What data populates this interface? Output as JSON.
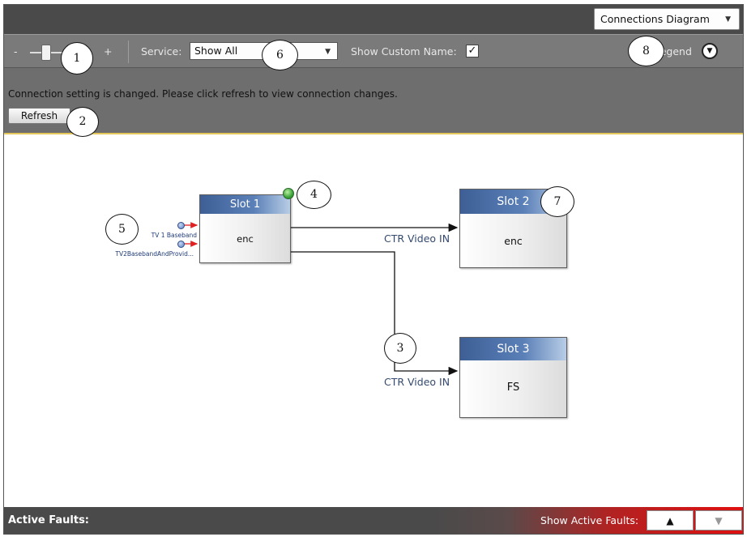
{
  "header": {
    "view_selector": "Connections Diagram",
    "view_caret": "▼"
  },
  "toolbar": {
    "zoom_minus": "-",
    "zoom_plus": "+",
    "zoom_level": 0.27,
    "service_label": "Service:",
    "service_value": "Show All",
    "service_caret": "▼",
    "custom_name_label": "Show Custom Name:",
    "custom_name_checked": true,
    "custom_name_mark": "✓",
    "legend_label": "Legend",
    "legend_toggle": "▼"
  },
  "notice": {
    "message": "Connection setting is changed. Please click refresh to view connection changes.",
    "refresh_label": "Refresh"
  },
  "diagram": {
    "slots": [
      {
        "title": "Slot 1",
        "body": "enc"
      },
      {
        "title": "Slot 2",
        "body": "enc"
      },
      {
        "title": "Slot 3",
        "body": "FS"
      }
    ],
    "inputs": [
      "TV 1 Baseband",
      "TV2BasebandAndProvid..."
    ],
    "connections": [
      {
        "from": "Slot 1",
        "to": "Slot 2",
        "label": "CTR Video IN"
      },
      {
        "from": "Slot 1",
        "to": "Slot 3",
        "label": "CTR Video IN"
      }
    ],
    "status_icon": "shield-ok-icon",
    "callouts": [
      "1",
      "2",
      "3",
      "4",
      "5",
      "6",
      "7",
      "8"
    ]
  },
  "footer": {
    "title": "Active Faults:",
    "show_label": "Show Active Faults:",
    "up_label": "▲",
    "down_label": "▼"
  },
  "colors": {
    "slot_header": "#3d5f96",
    "notice_accent": "#e6c85a",
    "fault_red": "#e01010",
    "port_arrow": "#e02020"
  }
}
